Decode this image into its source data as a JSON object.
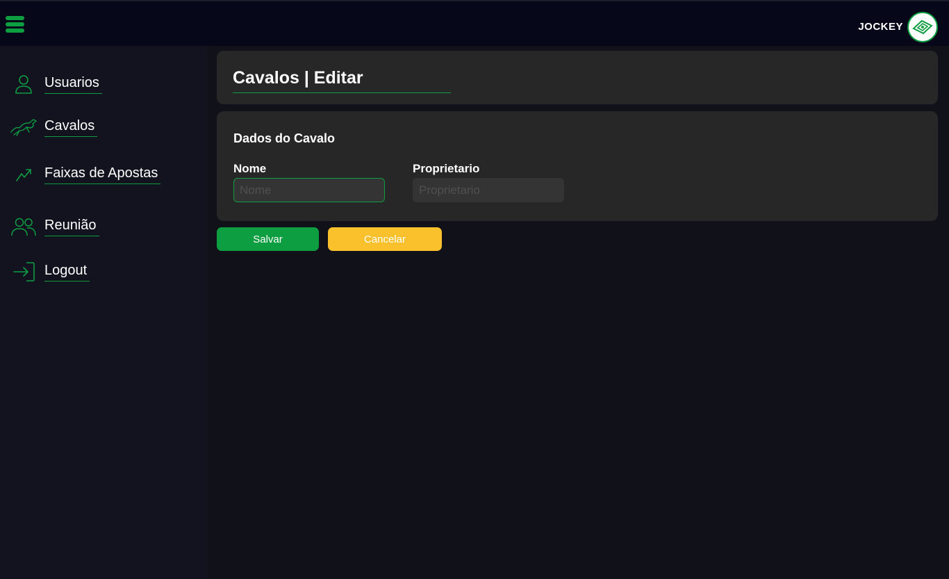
{
  "header": {
    "brand": "JOCKEY",
    "menu_icon": "hamburger-icon",
    "logo_icon": "jockey-logo-icon"
  },
  "sidebar": {
    "items": [
      {
        "label": "Usuarios",
        "icon": "user-icon"
      },
      {
        "label": "Cavalos",
        "icon": "horse-icon"
      },
      {
        "label": "Faixas de Apostas",
        "icon": "trending-up-icon"
      },
      {
        "label": "Reunião",
        "icon": "users-icon"
      },
      {
        "label": "Logout",
        "icon": "logout-icon"
      }
    ]
  },
  "page": {
    "title": "Cavalos | Editar"
  },
  "form": {
    "section_title": "Dados do Cavalo",
    "fields": [
      {
        "label": "Nome",
        "placeholder": "Nome",
        "value": ""
      },
      {
        "label": "Proprietario",
        "placeholder": "Proprietario",
        "value": ""
      }
    ]
  },
  "actions": {
    "save_label": "Salvar",
    "cancel_label": "Cancelar"
  },
  "colors": {
    "accent_green": "#0e9e42",
    "cancel_yellow": "#fbc12c",
    "card_bg": "#272727",
    "page_bg": "#11111a"
  }
}
